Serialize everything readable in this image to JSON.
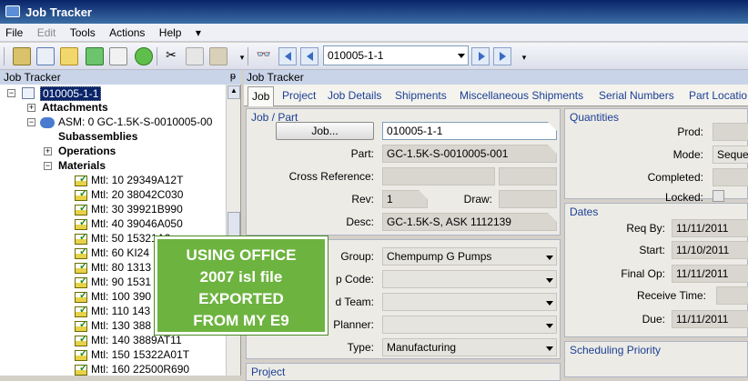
{
  "window": {
    "title": "Job Tracker"
  },
  "menu": {
    "items": [
      "File",
      "Edit",
      "Tools",
      "Actions",
      "Help"
    ]
  },
  "toolbar": {
    "record_value": "010005-1-1"
  },
  "left_panel": {
    "title": "Job Tracker",
    "tree": {
      "root": "010005-1-1",
      "attachments": "Attachments",
      "assembly": "ASM: 0 GC-1.5K-S-0010005-00",
      "subassemblies": "Subassemblies",
      "operations": "Operations",
      "materials": "Materials",
      "items": [
        "Mtl: 10 29349A12T",
        "Mtl: 20 38042C030",
        "Mtl: 30 39921B990",
        "Mtl: 40 39046A050",
        "Mtl: 50 15321A2",
        "Mtl: 60 KI24",
        "Mtl: 80 1313",
        "Mtl: 90 1531",
        "Mtl: 100 390",
        "Mtl: 110 143",
        "Mtl: 130 388",
        "Mtl: 140 3889AT11",
        "Mtl: 150 15322A01T",
        "Mtl: 160 22500R690"
      ]
    }
  },
  "right_panel": {
    "title": "Job Tracker",
    "tabs": [
      "Job",
      "Project",
      "Job Details",
      "Shipments",
      "Miscellaneous Shipments",
      "Serial Numbers",
      "Part Locatio"
    ],
    "job_part": {
      "title": "Job / Part",
      "job_button": "Job...",
      "job_value": "010005-1-1",
      "part_label": "Part:",
      "part_value": "GC-1.5K-S-0010005-001",
      "cross_ref_label": "Cross Reference:",
      "rev_label": "Rev:",
      "rev_value": "1",
      "draw_label": "Draw:",
      "desc_label": "Desc:",
      "desc_value": "GC-1.5K-S, ASK 1112139"
    },
    "group_block": {
      "group_label": "Group:",
      "group_value": "Chempump G Pumps",
      "prodcode_label": "p Code:",
      "team_label": "d Team:",
      "planner_label": "Planner:",
      "type_label": "Type:",
      "type_value": "Manufacturing"
    },
    "project": {
      "title": "Project"
    },
    "quantities": {
      "title": "Quantities",
      "prod_label": "Prod:",
      "mode_label": "Mode:",
      "mode_value": "Seque",
      "completed_label": "Completed:",
      "locked_label": "Locked:"
    },
    "dates": {
      "title": "Dates",
      "reqby_label": "Req By:",
      "reqby_value": "11/11/2011",
      "start_label": "Start:",
      "start_value": "11/10/2011",
      "finalop_label": "Final Op:",
      "finalop_value": "11/11/2011",
      "receive_label": "Receive Time:",
      "due_label": "Due:",
      "due_value": "11/11/2011"
    },
    "scheduling": {
      "title": "Scheduling Priority"
    }
  },
  "callout": {
    "lines": [
      "USING OFFICE",
      "2007 isl file",
      "EXPORTED",
      "FROM MY E9"
    ]
  },
  "colors": {
    "title_bar": "#0a246a",
    "link_blue": "#1c3f94",
    "callout_green": "#6db33f"
  }
}
